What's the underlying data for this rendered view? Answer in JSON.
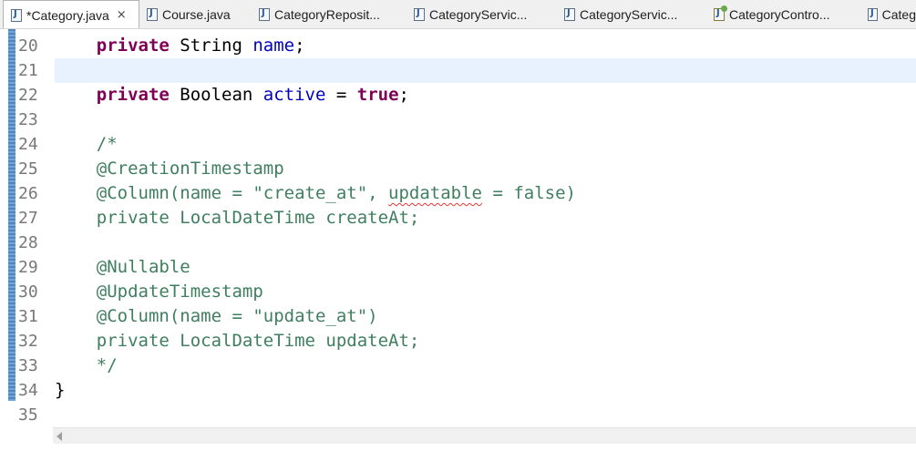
{
  "tabs": [
    {
      "label": "*Category.java",
      "icon": "java-file-icon",
      "active": true,
      "closable": true
    },
    {
      "label": "Course.java",
      "icon": "java-file-icon"
    },
    {
      "label": "CategoryReposit...",
      "icon": "java-file-icon"
    },
    {
      "label": "CategoryServic...",
      "icon": "java-file-icon"
    },
    {
      "label": "CategoryServic...",
      "icon": "java-file-icon"
    },
    {
      "label": "CategoryContro...",
      "icon": "java-controller-file-icon"
    },
    {
      "label": "Categ",
      "icon": "java-file-icon"
    }
  ],
  "tab_close_glyph": "×",
  "editor": {
    "current_line": "21",
    "colors": {
      "keyword": "#7f0055",
      "field": "#0000c0",
      "comment": "#3f7f5f",
      "current_line_bg": "#e8f2fe",
      "error_underline": "#e53935"
    },
    "lines": [
      {
        "no": "20",
        "indent": "    ",
        "kw1": "private",
        "t1": " String ",
        "field": "name",
        "t2": ";"
      },
      {
        "no": "21"
      },
      {
        "no": "22",
        "indent": "    ",
        "kw1": "private",
        "t1": " Boolean ",
        "field": "active",
        "t2": " = ",
        "kw2": "true",
        "t3": ";"
      },
      {
        "no": "23"
      },
      {
        "no": "24",
        "comment": "    /*"
      },
      {
        "no": "25",
        "comment": "    @CreationTimestamp"
      },
      {
        "no": "26",
        "comment_pre": "    @Column(name = \"create_at\", ",
        "comment_err": "updatable",
        "comment_post": " = false)"
      },
      {
        "no": "27",
        "comment": "    private LocalDateTime createAt;"
      },
      {
        "no": "28"
      },
      {
        "no": "29",
        "comment": "    @Nullable"
      },
      {
        "no": "30",
        "comment": "    @UpdateTimestamp"
      },
      {
        "no": "31",
        "comment": "    @Column(name = \"update_at\")"
      },
      {
        "no": "32",
        "comment": "    private LocalDateTime updateAt;"
      },
      {
        "no": "33",
        "comment": "    */"
      },
      {
        "no": "34",
        "text": "}"
      },
      {
        "no": "35"
      }
    ]
  }
}
